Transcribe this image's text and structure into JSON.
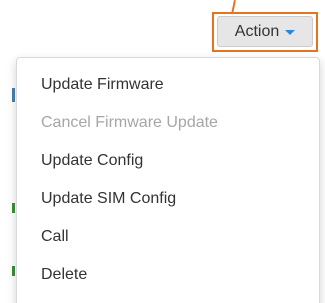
{
  "toolbar": {
    "action_label": "Action",
    "caret_icon": "caret-down-icon",
    "caret_color": "#2a88d8",
    "highlight_color": "#e8731e"
  },
  "menu": {
    "items": [
      {
        "label": "Update Firmware",
        "disabled": false
      },
      {
        "label": "Cancel Firmware Update",
        "disabled": true
      },
      {
        "label": "Update Config",
        "disabled": false
      },
      {
        "label": "Update SIM Config",
        "disabled": false
      },
      {
        "label": "Call",
        "disabled": false
      },
      {
        "label": "Delete",
        "disabled": false
      }
    ]
  }
}
